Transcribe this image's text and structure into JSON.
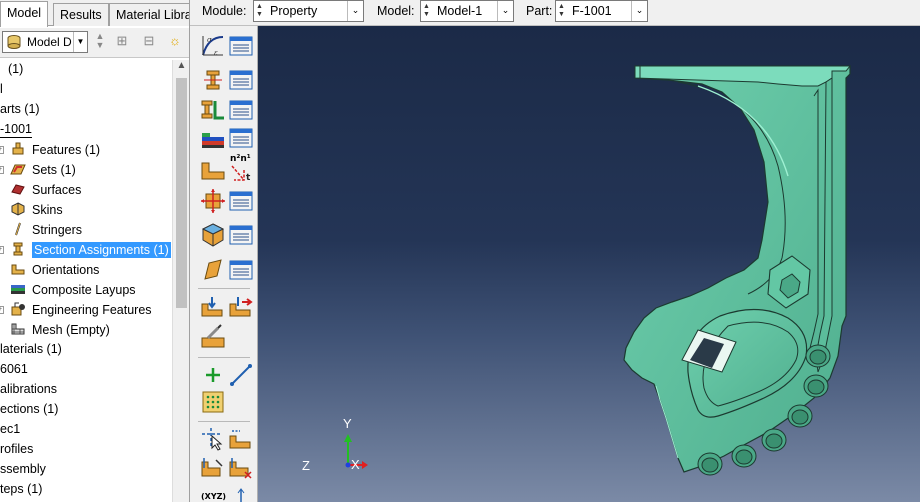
{
  "tabs": [
    {
      "label": "Model"
    },
    {
      "label": "Results"
    },
    {
      "label": "Material Libra"
    }
  ],
  "tree_toolbar": {
    "selector_value": "Model D"
  },
  "tree": {
    "nodes": [
      {
        "label": "(1)"
      },
      {
        "label": "l"
      },
      {
        "label": "arts (1)"
      },
      {
        "label": "-1001"
      },
      {
        "label": "Features (1)"
      },
      {
        "label": "Sets (1)"
      },
      {
        "label": "Surfaces"
      },
      {
        "label": "Skins"
      },
      {
        "label": "Stringers"
      },
      {
        "label": "Section Assignments (1)"
      },
      {
        "label": "Orientations"
      },
      {
        "label": "Composite Layups"
      },
      {
        "label": "Engineering Features"
      },
      {
        "label": "Mesh (Empty)"
      },
      {
        "label": "laterials (1)"
      },
      {
        "label": "6061"
      },
      {
        "label": "alibrations"
      },
      {
        "label": "ections (1)"
      },
      {
        "label": "ec1"
      },
      {
        "label": "rofiles"
      },
      {
        "label": "ssembly"
      },
      {
        "label": "teps (1)"
      }
    ]
  },
  "context_bar": {
    "module_label": "Module:",
    "module_value": "Property",
    "model_label": "Model:",
    "model_value": "Model-1",
    "part_label": "Part:",
    "part_value": "F-1001"
  },
  "triad": {
    "x_label": "X",
    "y_label": "Y",
    "z_label": "Z"
  },
  "toolbox": {
    "create_set_glyph": "n²n¹",
    "xyz_glyph": "(XYZ)"
  },
  "colors": {
    "part_fill": "#5fc0a0",
    "selection": "#3399ff",
    "viewport_top": "#1b2a47",
    "viewport_bottom": "#7b8aa6"
  }
}
